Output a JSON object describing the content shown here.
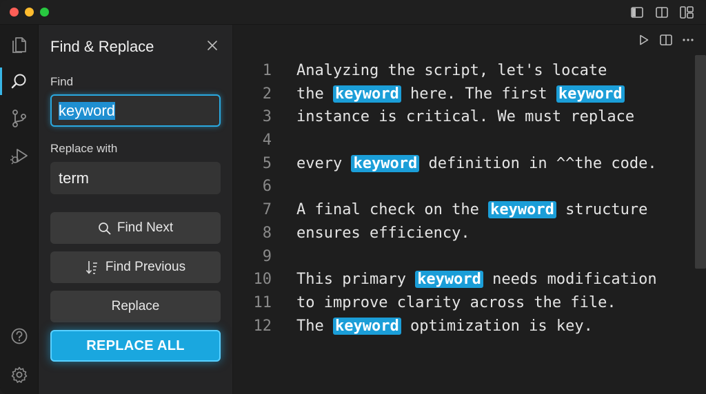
{
  "panel": {
    "title": "Find & Replace",
    "find_label": "Find",
    "find_value": "keyword",
    "replace_label": "Replace with",
    "replace_value": "term",
    "find_next_label": "Find Next",
    "find_previous_label": "Find Previous",
    "replace_label_btn": "Replace",
    "replace_all_label": "REPLACE ALL"
  },
  "editor": {
    "lines": [
      {
        "num": "1",
        "segments": [
          {
            "t": "Analyzing the script, let's locate",
            "hl": false
          }
        ]
      },
      {
        "num": "2",
        "segments": [
          {
            "t": "the ",
            "hl": false
          },
          {
            "t": "keyword",
            "hl": true
          },
          {
            "t": " here. The first ",
            "hl": false
          },
          {
            "t": "keyword",
            "hl": true
          }
        ]
      },
      {
        "num": "3",
        "segments": [
          {
            "t": "instance is critical. We must replace",
            "hl": false
          }
        ]
      },
      {
        "num": "4",
        "segments": []
      },
      {
        "num": "5",
        "segments": [
          {
            "t": "every ",
            "hl": false
          },
          {
            "t": "keyword",
            "hl": true
          },
          {
            "t": " definition in ^^the code.",
            "hl": false
          }
        ]
      },
      {
        "num": "6",
        "segments": []
      },
      {
        "num": "7",
        "segments": [
          {
            "t": "A final check on the ",
            "hl": false
          },
          {
            "t": "keyword",
            "hl": true
          },
          {
            "t": " structure",
            "hl": false
          }
        ]
      },
      {
        "num": "8",
        "segments": [
          {
            "t": "ensures efficiency.",
            "hl": false
          }
        ]
      },
      {
        "num": "9",
        "segments": []
      },
      {
        "num": "10",
        "segments": [
          {
            "t": "This primary ",
            "hl": false
          },
          {
            "t": "keyword",
            "hl": true
          },
          {
            "t": " needs modification",
            "hl": false
          }
        ]
      },
      {
        "num": "11",
        "segments": [
          {
            "t": "to improve clarity across the file.",
            "hl": false
          }
        ]
      },
      {
        "num": "12",
        "segments": [
          {
            "t": "The ",
            "hl": false
          },
          {
            "t": "keyword",
            "hl": true
          },
          {
            "t": " optimization is key.",
            "hl": false
          }
        ]
      }
    ]
  },
  "icons": {
    "activity": [
      "files-icon",
      "search-icon",
      "source-control-icon",
      "run-debug-icon",
      "help-icon",
      "settings-gear-icon"
    ],
    "titlebar": [
      "toggle-sidebar-icon",
      "toggle-panel-icon",
      "customize-layout-icon"
    ],
    "editor_toolbar": [
      "run-icon",
      "split-editor-icon",
      "more-actions-icon"
    ]
  },
  "colors": {
    "accent": "#1aa7df",
    "highlight": "#1b9ed8",
    "panel_bg": "#252526",
    "editor_bg": "#1e1e1e"
  }
}
